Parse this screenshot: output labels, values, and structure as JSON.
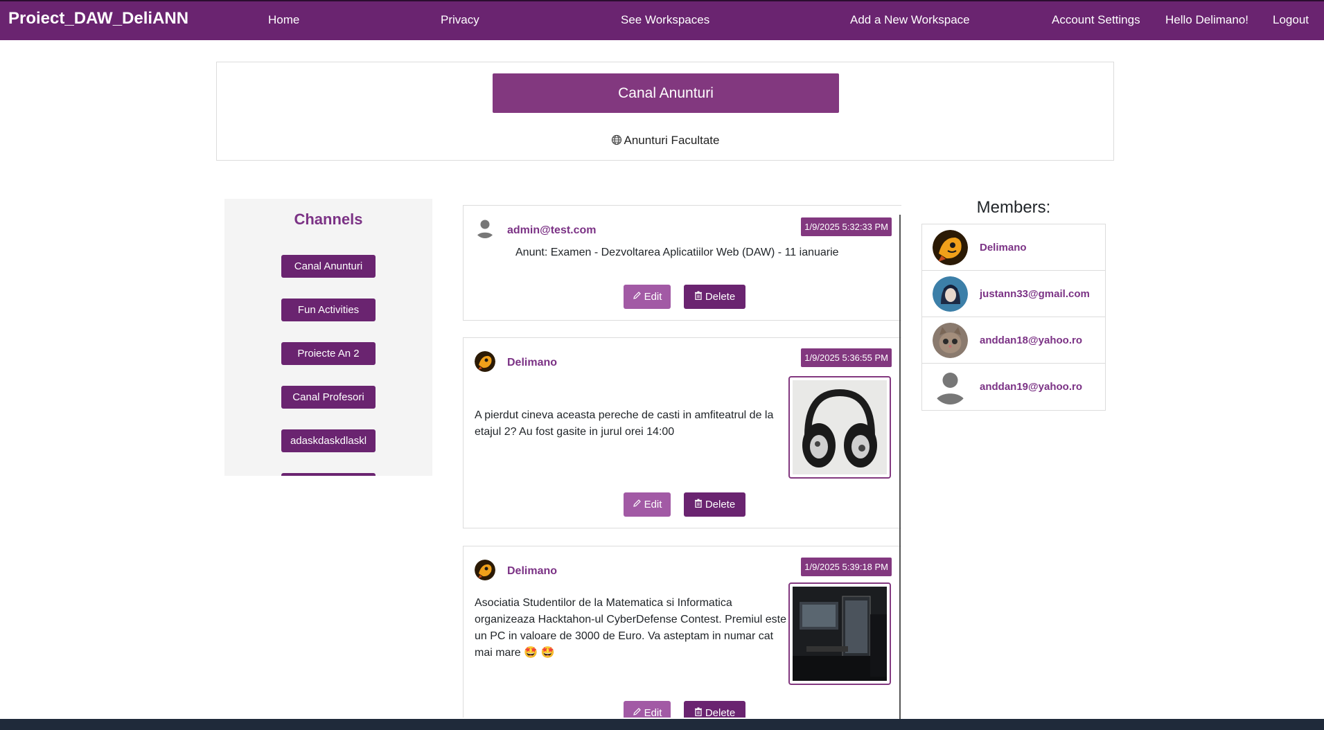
{
  "navbar": {
    "brand": "Proiect_DAW_DeliANN",
    "links": [
      "Home",
      "Privacy",
      "See Workspaces",
      "Add a New Workspace",
      "Account Settings",
      "Hello Delimano!",
      "Logout"
    ]
  },
  "header": {
    "channel_title": "Canal Anunturi",
    "workspace_name": "Anunturi Facultate"
  },
  "sidebar": {
    "title": "Channels",
    "channels": [
      "Canal Anunturi",
      "Fun Activities",
      "Proiecte An 2",
      "Canal Profesori",
      "adaskdaskdlaskl"
    ]
  },
  "posts": [
    {
      "author": "admin@test.com",
      "timestamp": "1/9/2025 5:32:33 PM",
      "text": "Anunt: Examen - Dezvoltarea Aplicatiilor Web (DAW) - 11 ianuarie",
      "edit_label": "Edit",
      "delete_label": "Delete"
    },
    {
      "author": "Delimano",
      "timestamp": "1/9/2025 5:36:55 PM",
      "text": "A pierdut cineva aceasta pereche de casti in amfiteatrul de la etajul 2? Au fost gasite in jurul orei 14:00",
      "edit_label": "Edit",
      "delete_label": "Delete"
    },
    {
      "author": "Delimano",
      "timestamp": "1/9/2025 5:39:18 PM",
      "text": "Asociatia Studentilor de la Matematica si Informatica organizeaza Hacktahon-ul CyberDefense Contest. Premiul este un PC in valoare de 3000 de Euro. Va asteptam in numar cat mai mare 🤩 🤩",
      "edit_label": "Edit",
      "delete_label": "Delete"
    }
  ],
  "members": {
    "title": "Members:",
    "list": [
      "Delimano",
      "justann33@gmail.com",
      "anddan18@yahoo.ro",
      "anddan19@yahoo.ro"
    ]
  },
  "colors": {
    "navbar": "#6a2470",
    "accent": "#82387f",
    "link": "#7b3285"
  }
}
